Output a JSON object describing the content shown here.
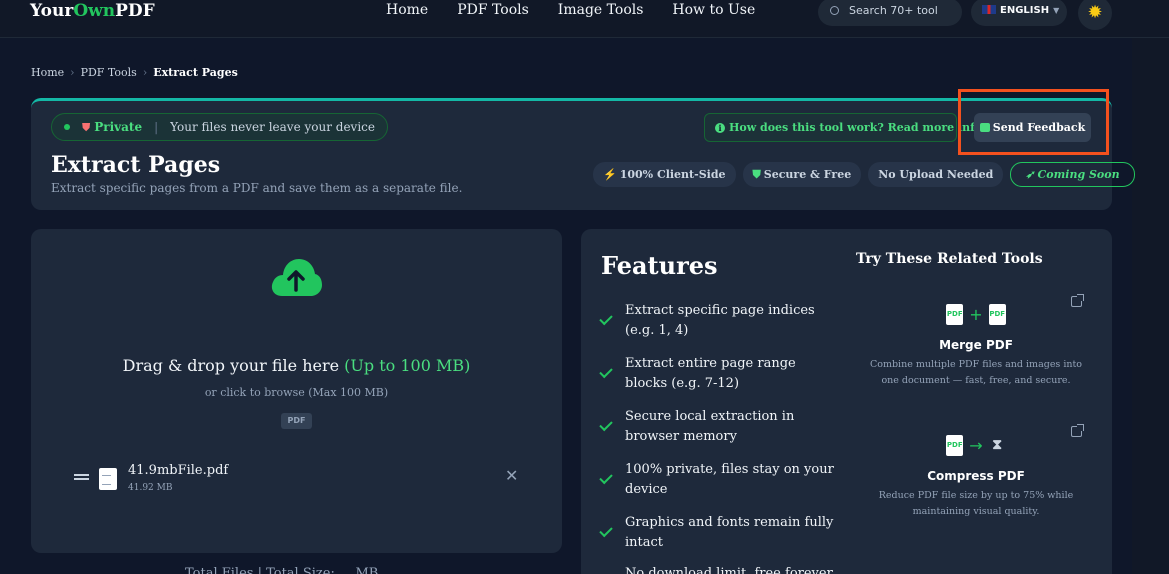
{
  "nav": {
    "logo_your": "Your",
    "logo_own": "Own",
    "logo_pdf": "PDF",
    "links": [
      "Home",
      "PDF Tools",
      "Image Tools",
      "How to Use"
    ],
    "search_placeholder": "Search 70+ tool",
    "language": "ENGLISH",
    "theme_icon": "sun-icon"
  },
  "breadcrumb": [
    "Home",
    "PDF Tools",
    "Extract Pages"
  ],
  "header": {
    "private_label": "Private",
    "private_text": "Your files never leave your device",
    "how_link": "How does this tool work? Read more info",
    "feedback_label": "Send Feedback",
    "title": "Extract Pages",
    "subtitle": "Extract specific pages from a PDF and save them as a separate file.",
    "badges": [
      "100% Client-Side",
      "Secure & Free",
      "No Upload Needed"
    ],
    "coming_soon": "Coming Soon"
  },
  "upload": {
    "drop_text": "Drag & drop your file here",
    "drop_limit": "(Up to 100 MB)",
    "browse_text": "or click to browse (Max 100 MB)",
    "type_tag": "PDF",
    "file": {
      "name": "41.9mbFile.pdf",
      "size": "41.92 MB"
    },
    "totals": "Total Files | Total Size: ... MB"
  },
  "features": {
    "title": "Features",
    "items": [
      "Extract specific page indices (e.g. 1, 4)",
      "Extract entire page range blocks (e.g. 7-12)",
      "Secure local extraction in browser memory",
      "100% private, files stay on your device",
      "Graphics and fonts remain fully intact"
    ],
    "partial_item": "No download limit, free forever"
  },
  "related": {
    "title": "Try These Related Tools",
    "tools": [
      {
        "name": "Merge PDF",
        "description": "Combine multiple PDF files and images into one document — fast, free, and secure."
      },
      {
        "name": "Compress PDF",
        "description": "Reduce PDF file size by up to 75% while maintaining visual quality."
      }
    ]
  },
  "colors": {
    "accent": "#22c55e",
    "background": "#0f172a",
    "card": "#1e293b",
    "highlight": "#f4511e"
  }
}
